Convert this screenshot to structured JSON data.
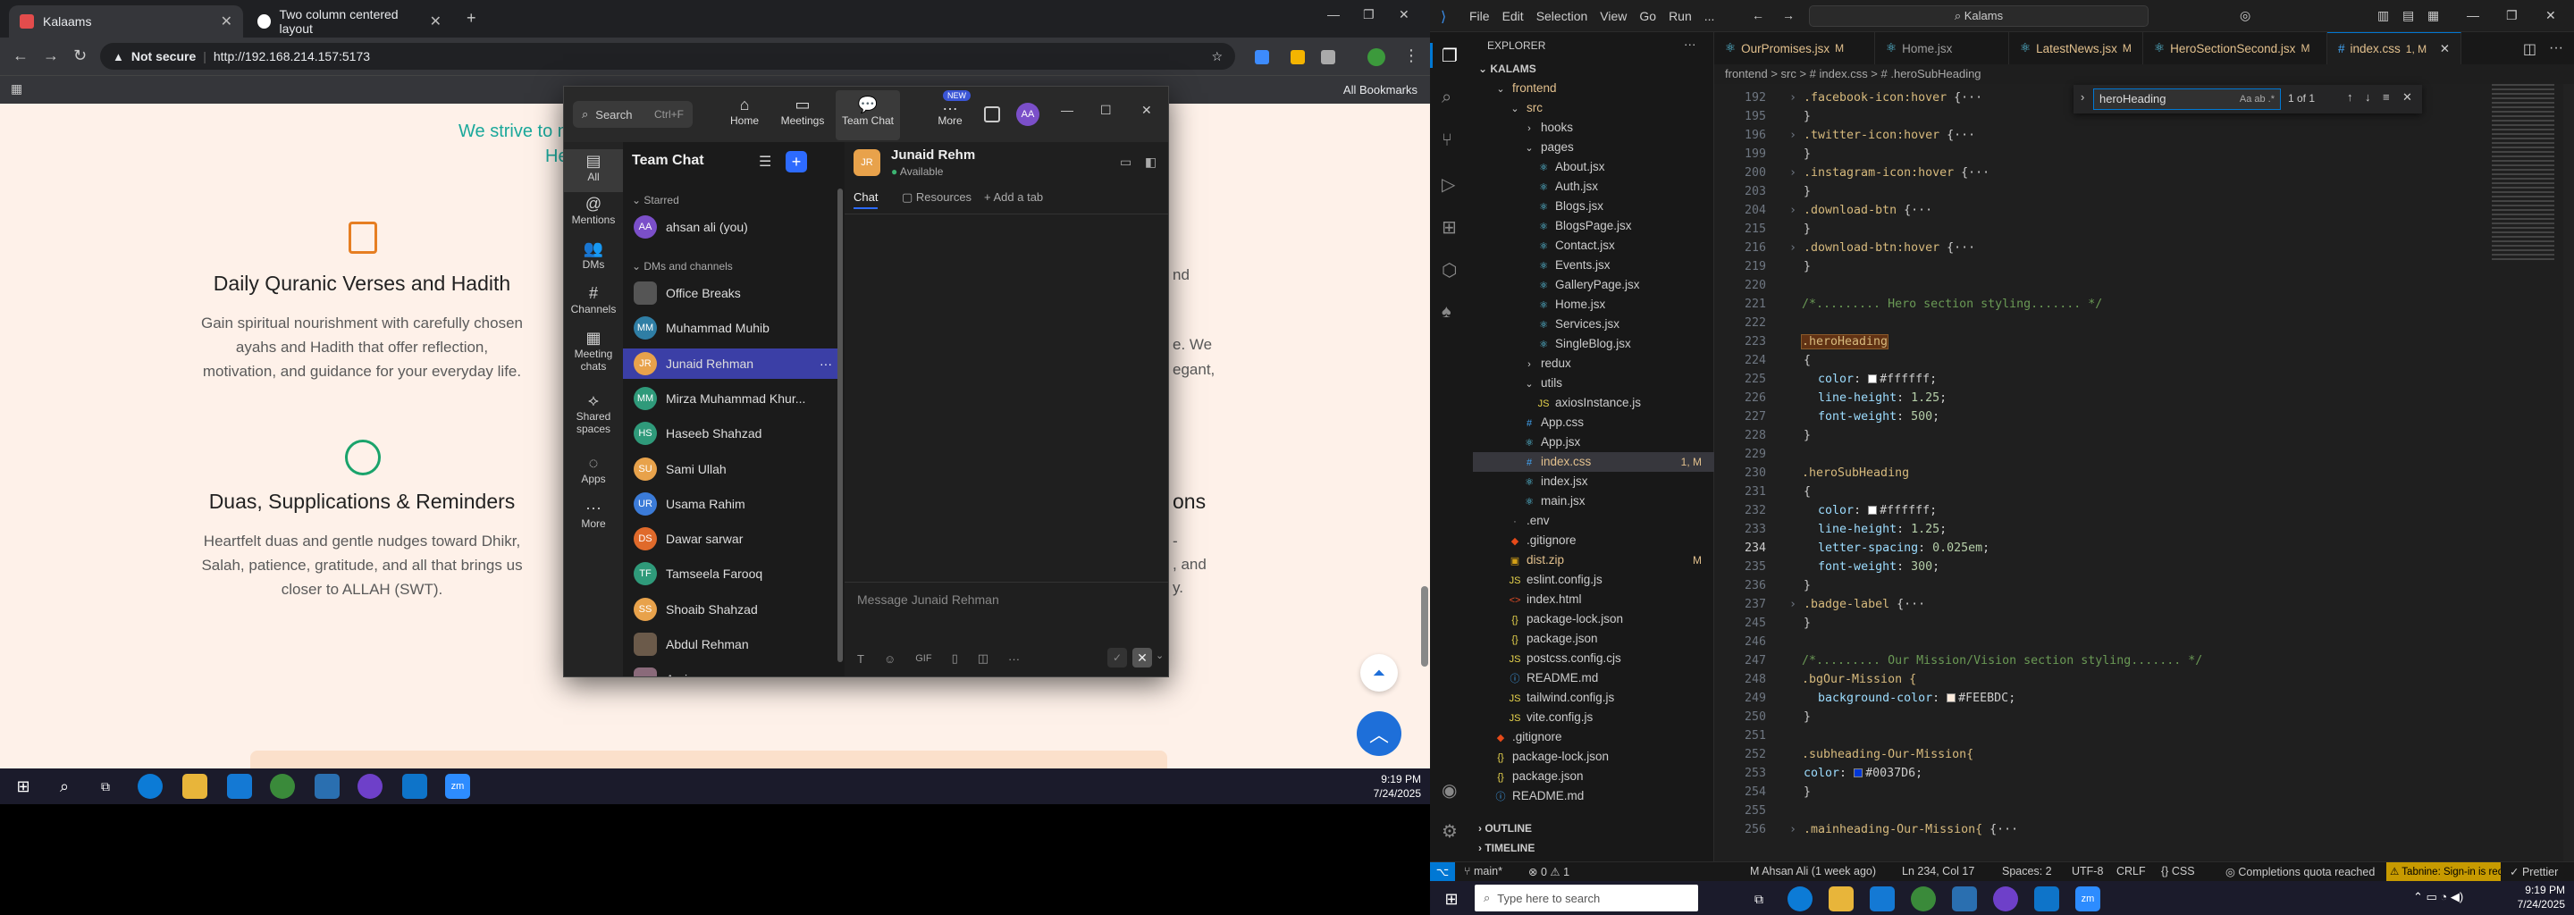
{
  "chrome": {
    "tabs": [
      {
        "title": "Kalaams",
        "active": true
      },
      {
        "title": "Two column centered layout",
        "active": false
      }
    ],
    "omnibox": {
      "security": "Not secure",
      "url": "http://192.168.214.157:5173"
    },
    "bookmarks_label": "All Bookmarks",
    "page": {
      "intro_line1": "We strive to m",
      "intro_line2": "He",
      "features": [
        {
          "title": "Daily Quranic Verses and Hadith",
          "desc1": "Gain spiritual nourishment with carefully chosen",
          "desc2": "ayahs and Hadith that offer reflection,",
          "desc3": "motivation, and guidance for your everyday life."
        },
        {
          "title": "Duas, Supplications & Reminders",
          "desc1": "Heartfelt duas and gentle nudges toward Dhikr,",
          "desc2": "Salah, patience, gratitude, and all that brings us",
          "desc3": "closer to ALLAH (SWT)."
        }
      ],
      "partial_right": [
        "nd",
        "e. We",
        "egant,",
        "ons",
        "-",
        ", and",
        "y."
      ]
    }
  },
  "teams": {
    "search": {
      "placeholder": "Search",
      "shortcut": "Ctrl+F"
    },
    "nav": [
      "Home",
      "Meetings",
      "Team Chat",
      "More"
    ],
    "new_badge": "NEW",
    "user_initials": "AA",
    "rail": [
      "All",
      "Mentions",
      "DMs",
      "Channels",
      "Meeting chats",
      "Shared spaces",
      "Apps",
      "More"
    ],
    "list_title": "Team Chat",
    "sections": {
      "starred": "Starred",
      "dms": "DMs and channels"
    },
    "starred_items": [
      {
        "name": "ahsan ali (you)",
        "initials": "AA",
        "color": "#7b4fc9"
      }
    ],
    "dm_items": [
      {
        "name": "Office Breaks",
        "initials": "",
        "color": "#555"
      },
      {
        "name": "Muhammad Muhib",
        "initials": "MM",
        "color": "#2f7ea5"
      },
      {
        "name": "Junaid Rehman",
        "initials": "JR",
        "color": "#e8a24b",
        "selected": true
      },
      {
        "name": "Mirza Muhammad Khur...",
        "initials": "MM",
        "color": "#2f9a7a"
      },
      {
        "name": "Haseeb Shahzad",
        "initials": "HS",
        "color": "#2f9a7a"
      },
      {
        "name": "Sami Ullah",
        "initials": "SU",
        "color": "#e8a24b"
      },
      {
        "name": "Usama Rahim",
        "initials": "UR",
        "color": "#3b7bd8"
      },
      {
        "name": "Dawar sarwar",
        "initials": "DS",
        "color": "#e06a2b"
      },
      {
        "name": "Tamseela Farooq",
        "initials": "TF",
        "color": "#2f9a7a"
      },
      {
        "name": "Shoaib Shahzad",
        "initials": "SS",
        "color": "#e8a24b"
      },
      {
        "name": "Abdul Rehman",
        "initials": "",
        "color": "#6b5a4a"
      },
      {
        "name": "Amina",
        "initials": "",
        "color": "#8a6a7a"
      }
    ],
    "chat": {
      "name": "Junaid Rehm",
      "status": "Available",
      "initials": "JR",
      "tabs": [
        "Chat",
        "Resources",
        "Add a tab"
      ],
      "compose_placeholder": "Message Junaid Rehman",
      "gif_label": "GIF"
    }
  },
  "vscode": {
    "menu": [
      "File",
      "Edit",
      "Selection",
      "View",
      "Go",
      "Run",
      "..."
    ],
    "search": "Kalams",
    "explorer_title": "EXPLORER",
    "root": "KALAMS",
    "tree": [
      {
        "label": "frontend",
        "depth": 1,
        "type": "folder-open",
        "color": "#e2c08d"
      },
      {
        "label": "src",
        "depth": 2,
        "type": "folder-open",
        "color": "#e2c08d"
      },
      {
        "label": "hooks",
        "depth": 3,
        "type": "folder",
        "color": "#ccc"
      },
      {
        "label": "pages",
        "depth": 3,
        "type": "folder-open",
        "color": "#ccc"
      },
      {
        "label": "About.jsx",
        "depth": 4,
        "type": "jsx",
        "color": "#ccc"
      },
      {
        "label": "Auth.jsx",
        "depth": 4,
        "type": "jsx",
        "color": "#ccc"
      },
      {
        "label": "Blogs.jsx",
        "depth": 4,
        "type": "jsx",
        "color": "#ccc"
      },
      {
        "label": "BlogsPage.jsx",
        "depth": 4,
        "type": "jsx",
        "color": "#ccc"
      },
      {
        "label": "Contact.jsx",
        "depth": 4,
        "type": "jsx",
        "color": "#ccc"
      },
      {
        "label": "Events.jsx",
        "depth": 4,
        "type": "jsx",
        "color": "#ccc"
      },
      {
        "label": "GalleryPage.jsx",
        "depth": 4,
        "type": "jsx",
        "color": "#ccc"
      },
      {
        "label": "Home.jsx",
        "depth": 4,
        "type": "jsx",
        "color": "#ccc"
      },
      {
        "label": "Services.jsx",
        "depth": 4,
        "type": "jsx",
        "color": "#ccc"
      },
      {
        "label": "SingleBlog.jsx",
        "depth": 4,
        "type": "jsx",
        "color": "#ccc"
      },
      {
        "label": "redux",
        "depth": 3,
        "type": "folder",
        "color": "#ccc"
      },
      {
        "label": "utils",
        "depth": 3,
        "type": "folder-open",
        "color": "#ccc"
      },
      {
        "label": "axiosInstance.js",
        "depth": 4,
        "type": "js",
        "color": "#ccc"
      },
      {
        "label": "App.css",
        "depth": 3,
        "type": "css",
        "color": "#ccc"
      },
      {
        "label": "App.jsx",
        "depth": 3,
        "type": "jsx",
        "color": "#ccc"
      },
      {
        "label": "index.css",
        "depth": 3,
        "type": "css",
        "color": "#e2c08d",
        "badge": "1, M",
        "selected": true
      },
      {
        "label": "index.jsx",
        "depth": 3,
        "type": "jsx",
        "color": "#ccc"
      },
      {
        "label": "main.jsx",
        "depth": 3,
        "type": "jsx",
        "color": "#ccc"
      },
      {
        "label": ".env",
        "depth": 2,
        "type": "file",
        "color": "#ccc"
      },
      {
        "label": ".gitignore",
        "depth": 2,
        "type": "git",
        "color": "#ccc"
      },
      {
        "label": "dist.zip",
        "depth": 2,
        "type": "zip",
        "color": "#e2c08d",
        "badge": "M"
      },
      {
        "label": "eslint.config.js",
        "depth": 2,
        "type": "js",
        "color": "#ccc"
      },
      {
        "label": "index.html",
        "depth": 2,
        "type": "html",
        "color": "#ccc"
      },
      {
        "label": "package-lock.json",
        "depth": 2,
        "type": "json",
        "color": "#ccc"
      },
      {
        "label": "package.json",
        "depth": 2,
        "type": "json",
        "color": "#ccc"
      },
      {
        "label": "postcss.config.cjs",
        "depth": 2,
        "type": "js",
        "color": "#ccc"
      },
      {
        "label": "README.md",
        "depth": 2,
        "type": "md",
        "color": "#ccc"
      },
      {
        "label": "tailwind.config.js",
        "depth": 2,
        "type": "js",
        "color": "#ccc"
      },
      {
        "label": "vite.config.js",
        "depth": 2,
        "type": "js",
        "color": "#ccc"
      },
      {
        "label": ".gitignore",
        "depth": 1,
        "type": "git",
        "color": "#ccc"
      },
      {
        "label": "package-lock.json",
        "depth": 1,
        "type": "json",
        "color": "#ccc"
      },
      {
        "label": "package.json",
        "depth": 1,
        "type": "json",
        "color": "#ccc"
      },
      {
        "label": "README.md",
        "depth": 1,
        "type": "md",
        "color": "#ccc"
      }
    ],
    "outline": "OUTLINE",
    "timeline": "TIMELINE",
    "tabs": [
      {
        "label": "OurPromises.jsx",
        "badge": "M"
      },
      {
        "label": "Home.jsx",
        "badge": ""
      },
      {
        "label": "LatestNews.jsx",
        "badge": "M"
      },
      {
        "label": "HeroSectionSecond.jsx",
        "badge": "M"
      },
      {
        "label": "index.css",
        "badge": "1, M",
        "active": true
      }
    ],
    "breadcrumb": "frontend > src > # index.css > # .heroSubHeading",
    "find": {
      "query": "heroHeading",
      "result": "1 of 1"
    },
    "lines": [
      {
        "n": "192",
        "t": "fold",
        "sel": ".facebook-icon:hover"
      },
      {
        "n": "195",
        "t": "close"
      },
      {
        "n": "196",
        "t": "fold",
        "sel": ".twitter-icon:hover"
      },
      {
        "n": "199",
        "t": "close"
      },
      {
        "n": "200",
        "t": "fold",
        "sel": ".instagram-icon:hover"
      },
      {
        "n": "203",
        "t": "close"
      },
      {
        "n": "204",
        "t": "fold",
        "sel": ".download-btn"
      },
      {
        "n": "215",
        "t": "close"
      },
      {
        "n": "216",
        "t": "fold",
        "sel": ".download-btn:hover"
      },
      {
        "n": "219",
        "t": "close"
      },
      {
        "n": "220",
        "t": "blank"
      },
      {
        "n": "221",
        "t": "comment",
        "text": "/*......... Hero section styling....... */"
      },
      {
        "n": "222",
        "t": "blank"
      },
      {
        "n": "223",
        "t": "sel",
        "sel": ".heroHeading"
      },
      {
        "n": "224",
        "t": "open"
      },
      {
        "n": "225",
        "t": "decl",
        "prop": "color",
        "swatch": "#ffffff",
        "val": "#ffffff"
      },
      {
        "n": "226",
        "t": "decl",
        "prop": "line-height",
        "val": "1.25"
      },
      {
        "n": "227",
        "t": "decl",
        "prop": "font-weight",
        "val": "500"
      },
      {
        "n": "228",
        "t": "close"
      },
      {
        "n": "229",
        "t": "blank"
      },
      {
        "n": "230",
        "t": "sel",
        "sel": ".heroSubHeading"
      },
      {
        "n": "231",
        "t": "open"
      },
      {
        "n": "232",
        "t": "decl",
        "prop": "color",
        "swatch": "#ffffff",
        "val": "#ffffff"
      },
      {
        "n": "233",
        "t": "decl",
        "prop": "line-height",
        "val": "1.25"
      },
      {
        "n": "234",
        "t": "decl",
        "prop": "letter-spacing",
        "val": "0.025em"
      },
      {
        "n": "235",
        "t": "decl",
        "prop": "font-weight",
        "val": "300"
      },
      {
        "n": "236",
        "t": "close"
      },
      {
        "n": "237",
        "t": "fold",
        "sel": ".badge-label"
      },
      {
        "n": "245",
        "t": "close"
      },
      {
        "n": "246",
        "t": "blank"
      },
      {
        "n": "247",
        "t": "comment",
        "text": "/*......... Our Mission/Vision section styling....... */"
      },
      {
        "n": "248",
        "t": "sel",
        "sel": ".bgOur-Mission {"
      },
      {
        "n": "249",
        "t": "decl",
        "prop": "background-color",
        "swatch": "#FEEBDC",
        "val": "#FEEBDC"
      },
      {
        "n": "250",
        "t": "close"
      },
      {
        "n": "251",
        "t": "blank"
      },
      {
        "n": "252",
        "t": "sel",
        "sel": ".subheading-Our-Mission{"
      },
      {
        "n": "253",
        "t": "decl0",
        "prop": "color",
        "swatch": "#0037D6",
        "val": "#0037D6"
      },
      {
        "n": "254",
        "t": "close"
      },
      {
        "n": "255",
        "t": "blank"
      },
      {
        "n": "256",
        "t": "fold",
        "sel": ".mainheading-Our-Mission{"
      }
    ],
    "status": {
      "branch": "main*",
      "problems": "0",
      "warnings": "1",
      "blame": "M Ahsan Ali (1 week ago)",
      "position": "Ln 234, Col 17",
      "spaces": "Spaces: 2",
      "encoding": "UTF-8",
      "eol": "CRLF",
      "language": "CSS",
      "quota": "Completions quota reached",
      "tabnine": "Tabnine: Sign-in is required",
      "prettier": "Prettier"
    }
  },
  "taskbar_left": {
    "time": "9:19 PM",
    "date": "7/24/2025"
  },
  "taskbar_right": {
    "search_placeholder": "Type here to search",
    "time": "9:19 PM",
    "date": "7/24/2025"
  }
}
